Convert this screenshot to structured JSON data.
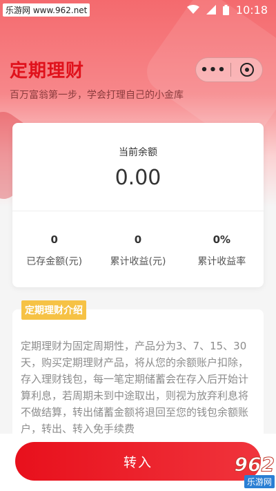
{
  "status_bar": {
    "site_label": "乐游网 www.962.net",
    "time": "10:18"
  },
  "header": {
    "title": "定期理财",
    "subtitle": "百万富翁第一步，学会打理自己的小金库",
    "more_label": "•••"
  },
  "balance_card": {
    "label": "当前余额",
    "amount": "0.00",
    "stats": [
      {
        "value": "0",
        "label": "已存金额(元)"
      },
      {
        "value": "0",
        "label": "累计收益(元)"
      },
      {
        "value": "0%",
        "label": "累计收益率"
      }
    ]
  },
  "intro": {
    "tag": "定期理财介绍",
    "text": "定期理财为固定周期性，产品分为3、7、15、30天，购买定期理财产品，将从您的余额账户扣除，存入理财钱包，每一笔定期储蓄会在存入后开始计算利息，若周期未到中途取出，则视为放弃利息将不做结算，转出储蓄金额将退回至您的钱包余额账户，转出、转入免手续费"
  },
  "footer": {
    "cta_label": "转入",
    "watermark_number": "962",
    "watermark_text": "乐游网"
  },
  "colors": {
    "accent": "#e0111b",
    "tag": "#f6c245"
  }
}
